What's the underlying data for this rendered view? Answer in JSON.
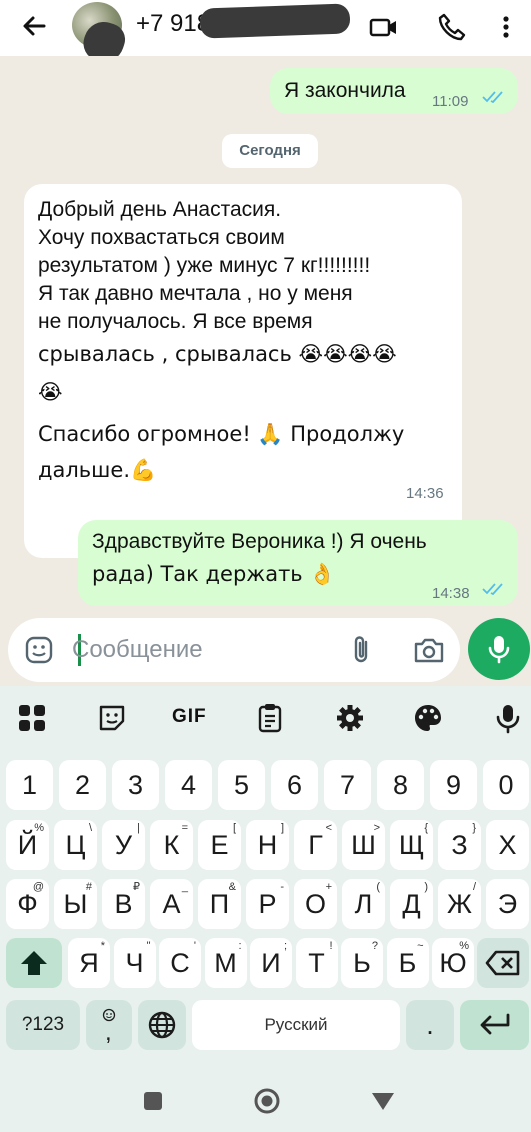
{
  "header": {
    "contact": "+7 918 ",
    "icons": [
      "back-arrow-icon",
      "video-call-icon",
      "phone-icon",
      "more-icon"
    ]
  },
  "chat": {
    "date_chip": "Сегодня",
    "messages": [
      {
        "direction": "out",
        "text": "Я закончила",
        "time": "11:09",
        "read": true
      },
      {
        "direction": "in",
        "lines": [
          "Добрый день Анастасия.",
          "Хочу похвастаться своим",
          "результатом ) уже минус 7 кг!!!!!!!!!",
          "Я так давно мечтала , но у меня",
          "не получалось. Я все время",
          "срывалась , срывалась 😭😭😭😭",
          "😭",
          "Спасибо огромное! 🙏 Продолжу",
          "дальше.💪"
        ],
        "time": "14:36"
      },
      {
        "direction": "out",
        "lines": [
          "Здравствуйте Вероника !) Я очень",
          "рада) Так держать 👌"
        ],
        "time": "14:38",
        "read": true
      }
    ]
  },
  "composer": {
    "placeholder": "Сообщение",
    "icons": [
      "emoji-icon",
      "attach-icon",
      "camera-icon",
      "mic-icon"
    ]
  },
  "keyboard": {
    "toolbar_icons": [
      "apps-grid-icon",
      "sticker-icon",
      "gif-icon",
      "clipboard-icon",
      "settings-icon",
      "palette-icon",
      "voice-input-icon"
    ],
    "gif_label": "GIF",
    "row_numbers": [
      "1",
      "2",
      "3",
      "4",
      "5",
      "6",
      "7",
      "8",
      "9",
      "0"
    ],
    "row1": [
      {
        "k": "Й",
        "h": "%"
      },
      {
        "k": "Ц",
        "h": "\\"
      },
      {
        "k": "У",
        "h": "|"
      },
      {
        "k": "К",
        "h": "="
      },
      {
        "k": "Е",
        "h": "["
      },
      {
        "k": "Н",
        "h": "]"
      },
      {
        "k": "Г",
        "h": "<"
      },
      {
        "k": "Ш",
        "h": ">"
      },
      {
        "k": "Щ",
        "h": "{"
      },
      {
        "k": "З",
        "h": "}"
      },
      {
        "k": "Х",
        "h": ""
      }
    ],
    "row2": [
      {
        "k": "Ф",
        "h": "@"
      },
      {
        "k": "Ы",
        "h": "#"
      },
      {
        "k": "В",
        "h": "₽"
      },
      {
        "k": "А",
        "h": "_"
      },
      {
        "k": "П",
        "h": "&"
      },
      {
        "k": "Р",
        "h": "-"
      },
      {
        "k": "О",
        "h": "+"
      },
      {
        "k": "Л",
        "h": "("
      },
      {
        "k": "Д",
        "h": ")"
      },
      {
        "k": "Ж",
        "h": "/"
      },
      {
        "k": "Э",
        "h": ""
      }
    ],
    "row3": [
      {
        "k": "Я",
        "h": "*"
      },
      {
        "k": "Ч",
        "h": "\""
      },
      {
        "k": "С",
        "h": "'"
      },
      {
        "k": "М",
        "h": ":"
      },
      {
        "k": "И",
        "h": ";"
      },
      {
        "k": "Т",
        "h": "!"
      },
      {
        "k": "Ь",
        "h": "?"
      },
      {
        "k": "Б",
        "h": "~"
      },
      {
        "k": "Ю",
        "h": "%"
      }
    ],
    "symbols_label": "?123",
    "emoji_comma_label": ",",
    "space_label": "Русский",
    "period_label": "."
  },
  "navbar": {
    "icons": [
      "recents-icon",
      "home-icon",
      "back-nav-icon"
    ]
  }
}
